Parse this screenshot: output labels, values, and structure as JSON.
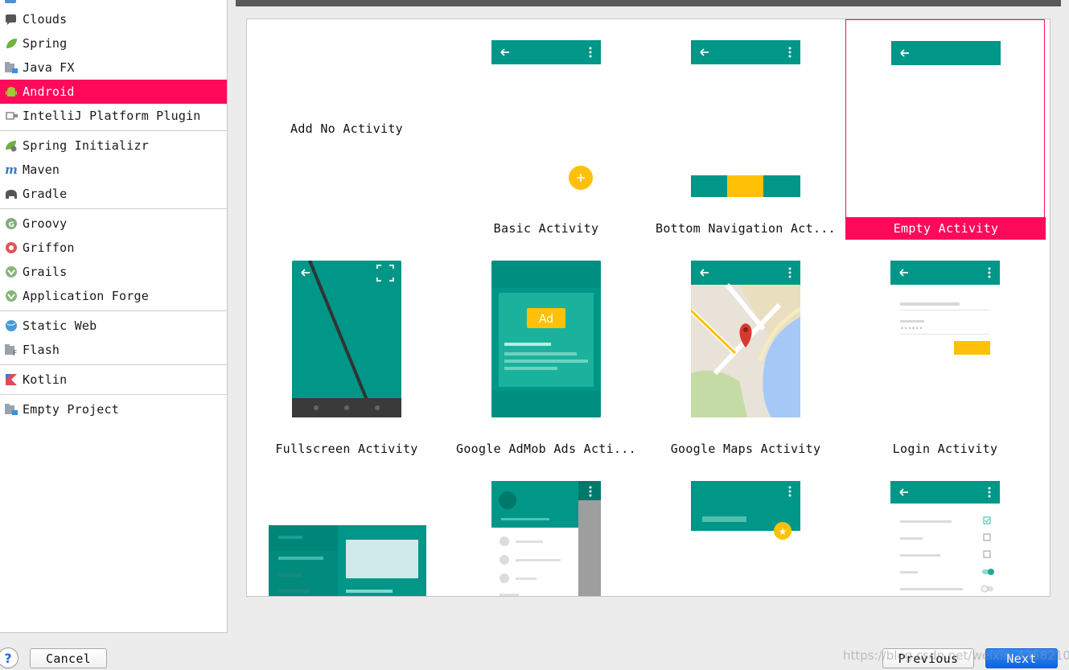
{
  "sidebar": {
    "items": [
      {
        "label": "Clouds",
        "icon": "cloud-icon"
      },
      {
        "label": "Spring",
        "icon": "spring-leaf-icon"
      },
      {
        "label": "Java FX",
        "icon": "folder-icon"
      },
      {
        "label": "Android",
        "icon": "android-icon",
        "selected": true
      },
      {
        "label": "IntelliJ Platform Plugin",
        "icon": "plugin-icon"
      },
      {
        "label": "Spring Initializr",
        "icon": "spring-initializr-icon"
      },
      {
        "label": "Maven",
        "icon": "maven-icon"
      },
      {
        "label": "Gradle",
        "icon": "gradle-elephant-icon"
      },
      {
        "label": "Groovy",
        "icon": "groovy-icon"
      },
      {
        "label": "Griffon",
        "icon": "griffon-icon"
      },
      {
        "label": "Grails",
        "icon": "grails-icon"
      },
      {
        "label": "Application Forge",
        "icon": "grails-icon"
      },
      {
        "label": "Static Web",
        "icon": "globe-icon"
      },
      {
        "label": "Flash",
        "icon": "flash-folder-icon"
      },
      {
        "label": "Kotlin",
        "icon": "kotlin-icon"
      },
      {
        "label": "Empty Project",
        "icon": "folder-icon"
      }
    ]
  },
  "gallery": {
    "tiles": [
      {
        "label": "Add No Activity",
        "type": "none"
      },
      {
        "label": "Basic Activity",
        "type": "basic"
      },
      {
        "label": "Bottom Navigation Act...",
        "type": "bottomnav"
      },
      {
        "label": "Empty Activity",
        "type": "empty",
        "selected": true
      },
      {
        "label": "Fullscreen Activity",
        "type": "fullscreen"
      },
      {
        "label": "Google AdMob Ads Acti...",
        "type": "admob",
        "badge": "Ad"
      },
      {
        "label": "Google Maps Activity",
        "type": "maps"
      },
      {
        "label": "Login Activity",
        "type": "login"
      },
      {
        "label": "",
        "type": "masterdetail"
      },
      {
        "label": "",
        "type": "navdrawer"
      },
      {
        "label": "",
        "type": "scrolling"
      },
      {
        "label": "",
        "type": "settings"
      }
    ]
  },
  "buttons": {
    "help": "?",
    "cancel": "Cancel",
    "previous": "Previous",
    "next": "Next"
  },
  "watermark": "https://blog.csdn.net/weixin_43582101",
  "colors": {
    "accent": "#ff0a5a",
    "teal": "#009688",
    "teal_dark": "#00796b",
    "amber": "#ffc107",
    "primary_button": "#1163e0"
  }
}
